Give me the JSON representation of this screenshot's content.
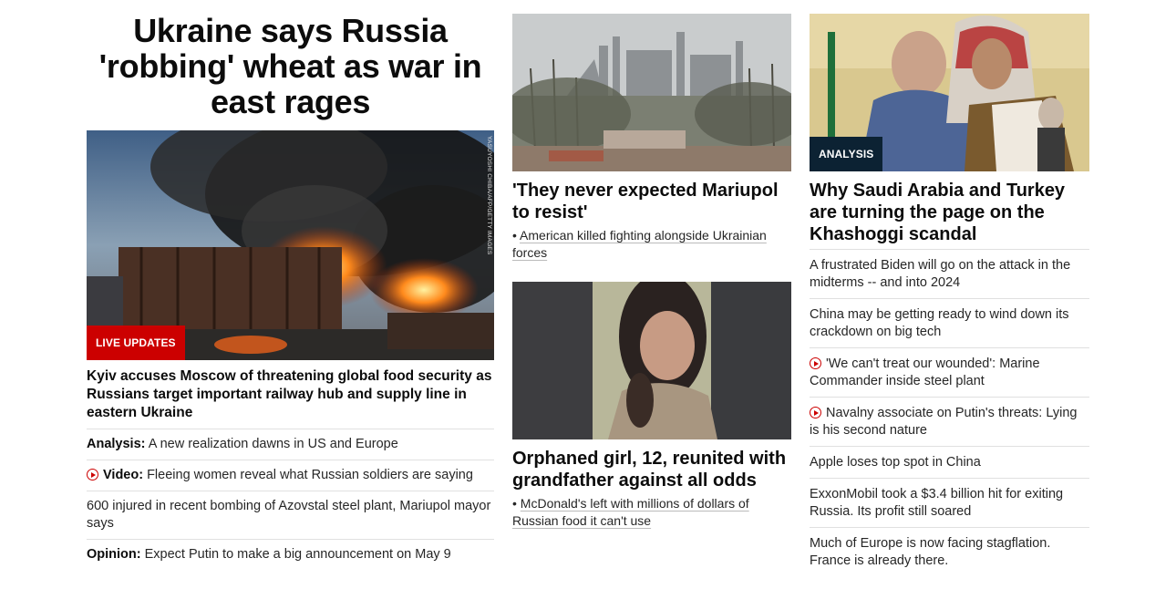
{
  "col1": {
    "hero_title": "Ukraine says Russia 'robbing' wheat as war in east rages",
    "image": {
      "alt": "Burning train cars with black smoke",
      "credit": "YASUYOSHI CHIBA/AFP/GETTY IMAGES"
    },
    "badge": "LIVE UPDATES",
    "lead_headline": "Kyiv accuses Moscow of threatening global food security as Russians target important railway hub and supply line in eastern Ukraine",
    "items": [
      {
        "label": "Analysis:",
        "text": "A new realization dawns in US and Europe",
        "video": false
      },
      {
        "label": "Video:",
        "text": "Fleeing women reveal what Russian soldiers are saying",
        "video": true
      },
      {
        "label": "",
        "text": "600 injured in recent bombing of Azovstal steel plant, Mariupol mayor says",
        "video": false
      },
      {
        "label": "Opinion:",
        "text": "Expect Putin to make a big announcement on May 9",
        "video": false
      }
    ]
  },
  "col2": {
    "story1": {
      "image": {
        "alt": "Smoke over Azovstal steel plant in Mariupol"
      },
      "headline": "'They never expected Mariupol to resist'",
      "sub": "American killed fighting alongside Ukrainian forces"
    },
    "story2": {
      "image": {
        "alt": "Portrait of a young girl"
      },
      "headline": "Orphaned girl, 12, reunited with grandfather against all odds",
      "sub": "McDonald's left with millions of dollars of Russian food it can't use"
    }
  },
  "col3": {
    "image": {
      "alt": "Erdogan embracing Mohammed bin Salman"
    },
    "badge": "ANALYSIS",
    "headline": "Why Saudi Arabia and Turkey are turning the page on the Khashoggi scandal",
    "items": [
      {
        "text": "A frustrated Biden will go on the attack in the midterms -- and into 2024",
        "video": false
      },
      {
        "text": "China may be getting ready to wind down its crackdown on big tech",
        "video": false
      },
      {
        "text": "'We can't treat our wounded': Marine Commander inside steel plant",
        "video": true
      },
      {
        "text": "Navalny associate on Putin's threats: Lying is his second nature",
        "video": true
      },
      {
        "text": "Apple loses top spot in China",
        "video": false
      },
      {
        "text": "ExxonMobil took a $3.4 billion hit for exiting Russia. Its profit still soared",
        "video": false
      },
      {
        "text": "Much of Europe is now facing stagflation. France is already there.",
        "video": false
      }
    ]
  },
  "colors": {
    "live_red": "#cc0000",
    "analysis_navy": "#0c2233",
    "divider": "#e0e0e0"
  },
  "icons": {
    "video": "play-circle-icon"
  }
}
